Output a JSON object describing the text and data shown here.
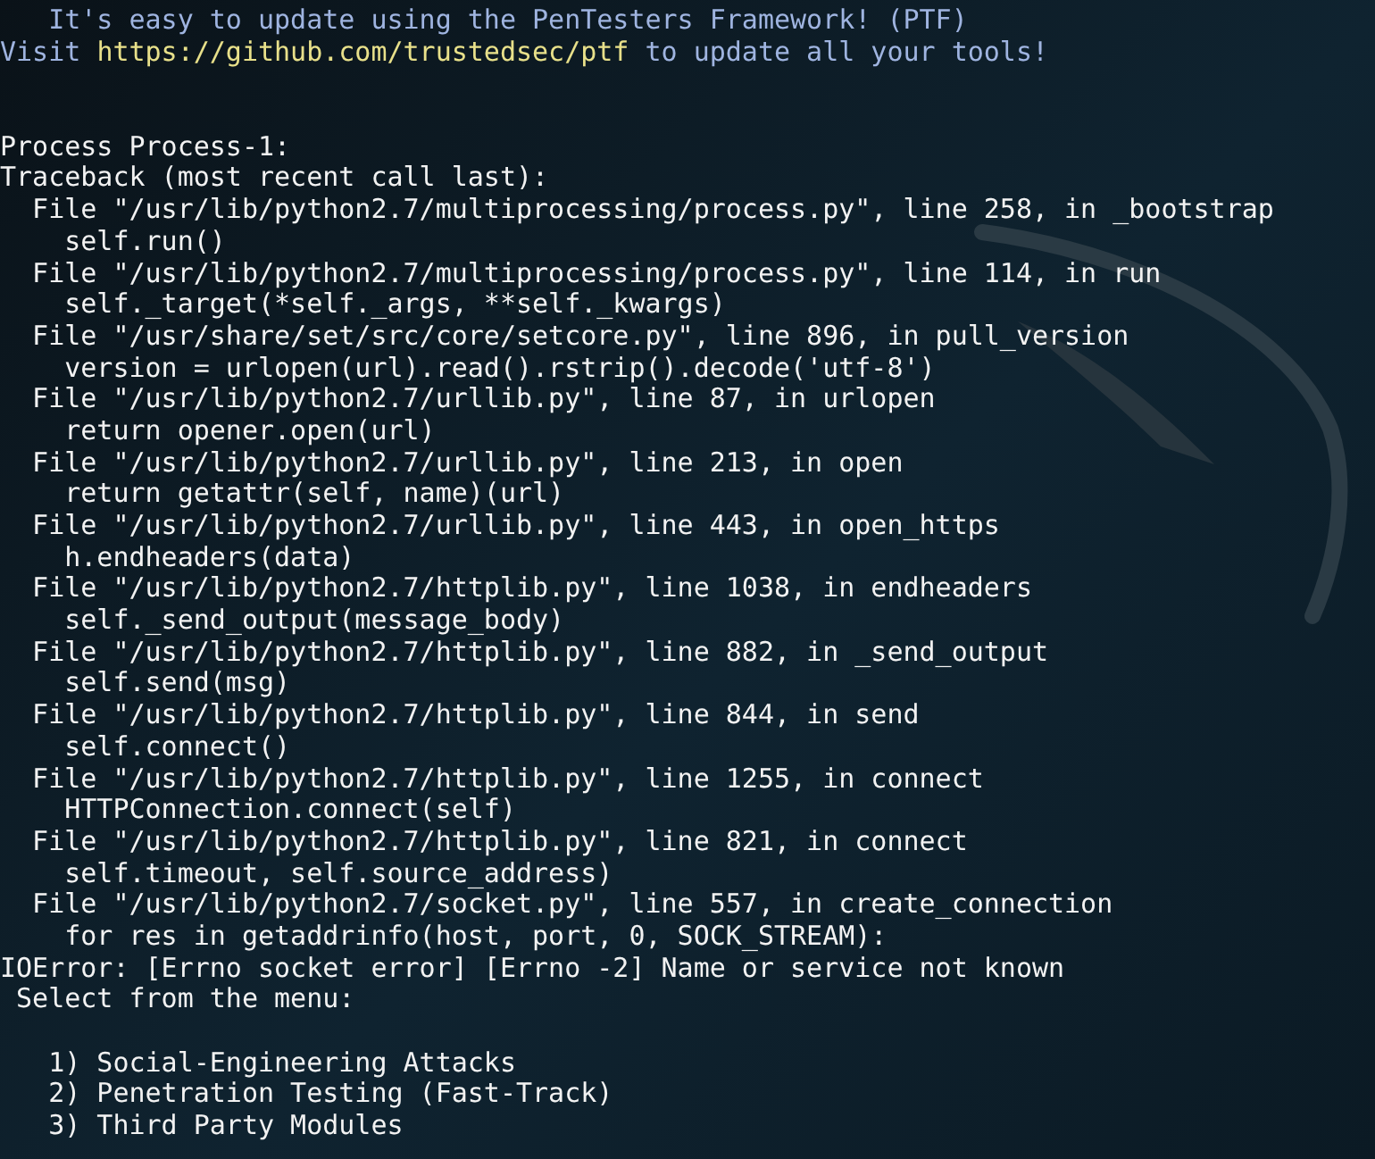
{
  "terminal": {
    "lines": [
      {
        "kind": "banner",
        "text": "   It's easy to update using the PenTesters Framework! (PTF)"
      },
      {
        "kind": "link",
        "before": "Visit ",
        "link": "https://github.com/trustedsec/ptf",
        "after": " to update all your tools!"
      },
      {
        "kind": "blank"
      },
      {
        "kind": "blank"
      },
      {
        "kind": "plain",
        "text": "Process Process-1:"
      },
      {
        "kind": "plain",
        "text": "Traceback (most recent call last):"
      },
      {
        "kind": "plain",
        "text": "  File \"/usr/lib/python2.7/multiprocessing/process.py\", line 258, in _bootstrap"
      },
      {
        "kind": "plain",
        "text": "    self.run()"
      },
      {
        "kind": "plain",
        "text": "  File \"/usr/lib/python2.7/multiprocessing/process.py\", line 114, in run"
      },
      {
        "kind": "plain",
        "text": "    self._target(*self._args, **self._kwargs)"
      },
      {
        "kind": "plain",
        "text": "  File \"/usr/share/set/src/core/setcore.py\", line 896, in pull_version"
      },
      {
        "kind": "plain",
        "text": "    version = urlopen(url).read().rstrip().decode('utf-8')"
      },
      {
        "kind": "plain",
        "text": "  File \"/usr/lib/python2.7/urllib.py\", line 87, in urlopen"
      },
      {
        "kind": "plain",
        "text": "    return opener.open(url)"
      },
      {
        "kind": "plain",
        "text": "  File \"/usr/lib/python2.7/urllib.py\", line 213, in open"
      },
      {
        "kind": "plain",
        "text": "    return getattr(self, name)(url)"
      },
      {
        "kind": "plain",
        "text": "  File \"/usr/lib/python2.7/urllib.py\", line 443, in open_https"
      },
      {
        "kind": "plain",
        "text": "    h.endheaders(data)"
      },
      {
        "kind": "plain",
        "text": "  File \"/usr/lib/python2.7/httplib.py\", line 1038, in endheaders"
      },
      {
        "kind": "plain",
        "text": "    self._send_output(message_body)"
      },
      {
        "kind": "plain",
        "text": "  File \"/usr/lib/python2.7/httplib.py\", line 882, in _send_output"
      },
      {
        "kind": "plain",
        "text": "    self.send(msg)"
      },
      {
        "kind": "plain",
        "text": "  File \"/usr/lib/python2.7/httplib.py\", line 844, in send"
      },
      {
        "kind": "plain",
        "text": "    self.connect()"
      },
      {
        "kind": "plain",
        "text": "  File \"/usr/lib/python2.7/httplib.py\", line 1255, in connect"
      },
      {
        "kind": "plain",
        "text": "    HTTPConnection.connect(self)"
      },
      {
        "kind": "plain",
        "text": "  File \"/usr/lib/python2.7/httplib.py\", line 821, in connect"
      },
      {
        "kind": "plain",
        "text": "    self.timeout, self.source_address)"
      },
      {
        "kind": "plain",
        "text": "  File \"/usr/lib/python2.7/socket.py\", line 557, in create_connection"
      },
      {
        "kind": "plain",
        "text": "    for res in getaddrinfo(host, port, 0, SOCK_STREAM):"
      },
      {
        "kind": "plain",
        "text": "IOError: [Errno socket error] [Errno -2] Name or service not known"
      },
      {
        "kind": "plain",
        "text": " Select from the menu:"
      },
      {
        "kind": "blank"
      },
      {
        "kind": "plain",
        "text": "   1) Social-Engineering Attacks"
      },
      {
        "kind": "plain",
        "text": "   2) Penetration Testing (Fast-Track)"
      },
      {
        "kind": "plain",
        "text": "   3) Third Party Modules"
      }
    ]
  }
}
